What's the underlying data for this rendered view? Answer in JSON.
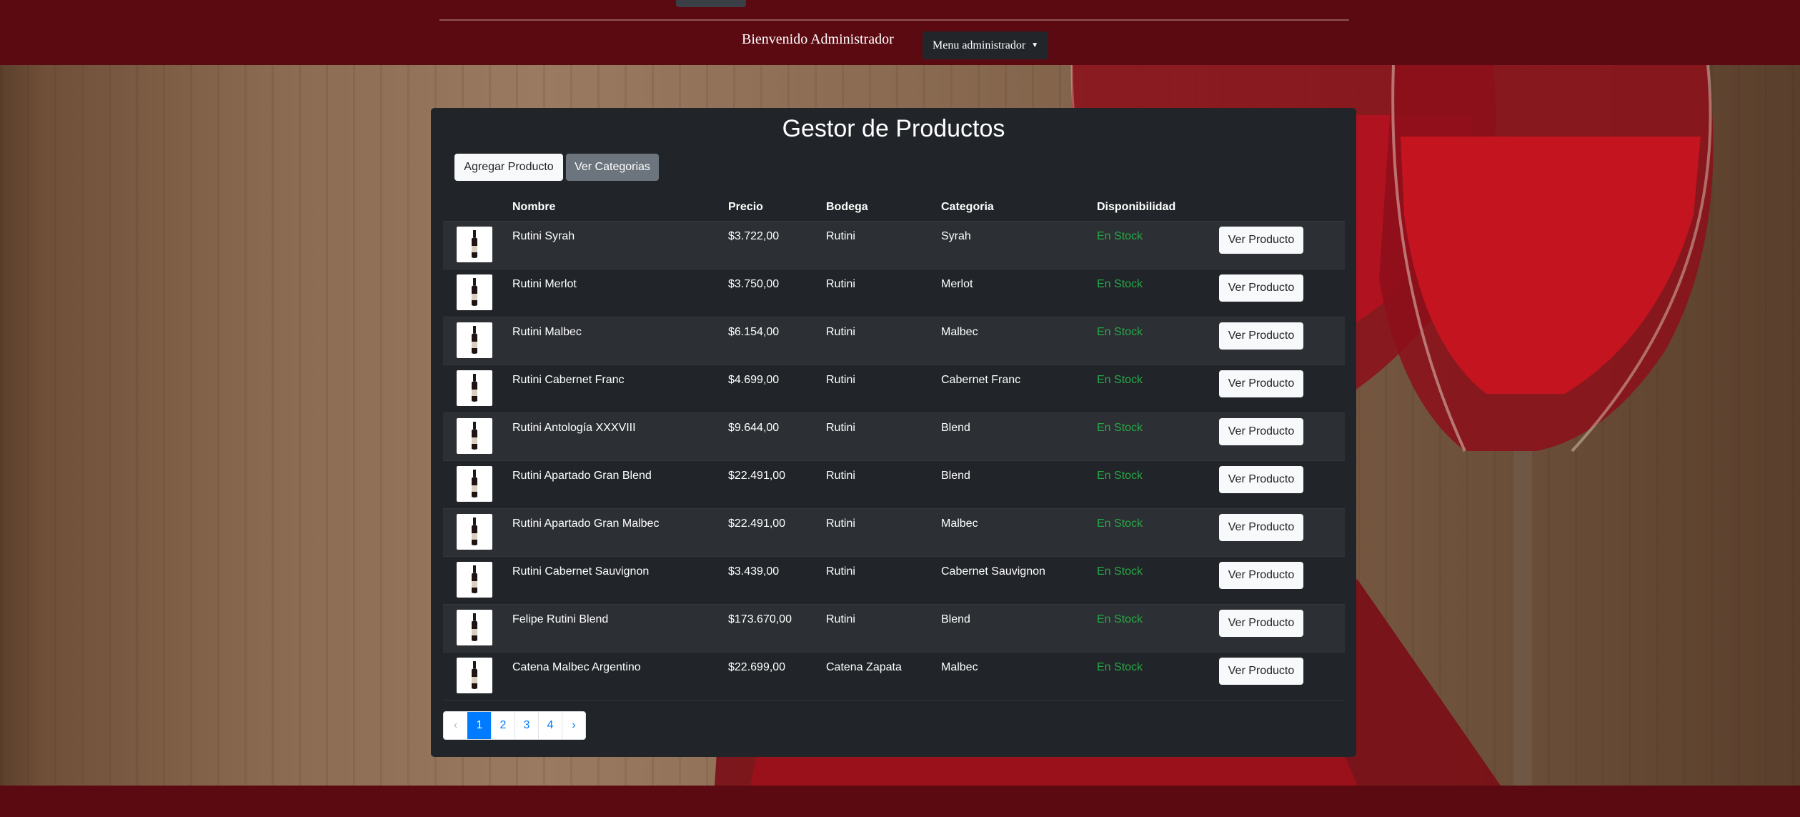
{
  "header": {
    "welcome": "Bienvenido Administrador",
    "admin_menu_label": "Menu administrador",
    "brand_color": "#5c0a12"
  },
  "panel": {
    "title": "Gestor de Productos",
    "add_button": "Agregar Producto",
    "categories_button": "Ver Categorias"
  },
  "table": {
    "headers": [
      "",
      "Nombre",
      "Precio",
      "Bodega",
      "Categoria",
      "Disponibilidad",
      ""
    ],
    "view_button_label": "Ver Producto",
    "rows": [
      {
        "nombre": "Rutini Syrah",
        "precio": "$3.722,00",
        "bodega": "Rutini",
        "categoria": "Syrah",
        "disponibilidad": "En Stock"
      },
      {
        "nombre": "Rutini Merlot",
        "precio": "$3.750,00",
        "bodega": "Rutini",
        "categoria": "Merlot",
        "disponibilidad": "En Stock"
      },
      {
        "nombre": "Rutini Malbec",
        "precio": "$6.154,00",
        "bodega": "Rutini",
        "categoria": "Malbec",
        "disponibilidad": "En Stock"
      },
      {
        "nombre": "Rutini Cabernet Franc",
        "precio": "$4.699,00",
        "bodega": "Rutini",
        "categoria": "Cabernet Franc",
        "disponibilidad": "En Stock"
      },
      {
        "nombre": "Rutini Antología XXXVIII",
        "precio": "$9.644,00",
        "bodega": "Rutini",
        "categoria": "Blend",
        "disponibilidad": "En Stock"
      },
      {
        "nombre": "Rutini Apartado Gran Blend",
        "precio": "$22.491,00",
        "bodega": "Rutini",
        "categoria": "Blend",
        "disponibilidad": "En Stock"
      },
      {
        "nombre": "Rutini Apartado Gran Malbec",
        "precio": "$22.491,00",
        "bodega": "Rutini",
        "categoria": "Malbec",
        "disponibilidad": "En Stock"
      },
      {
        "nombre": "Rutini Cabernet Sauvignon",
        "precio": "$3.439,00",
        "bodega": "Rutini",
        "categoria": "Cabernet Sauvignon",
        "disponibilidad": "En Stock"
      },
      {
        "nombre": "Felipe Rutini Blend",
        "precio": "$173.670,00",
        "bodega": "Rutini",
        "categoria": "Blend",
        "disponibilidad": "En Stock"
      },
      {
        "nombre": "Catena Malbec Argentino",
        "precio": "$22.699,00",
        "bodega": "Catena Zapata",
        "categoria": "Malbec",
        "disponibilidad": "En Stock"
      }
    ],
    "stock_color": "#28a745"
  },
  "pagination": {
    "prev": "‹",
    "pages": [
      "1",
      "2",
      "3",
      "4"
    ],
    "next": "›",
    "active_page": "1"
  }
}
